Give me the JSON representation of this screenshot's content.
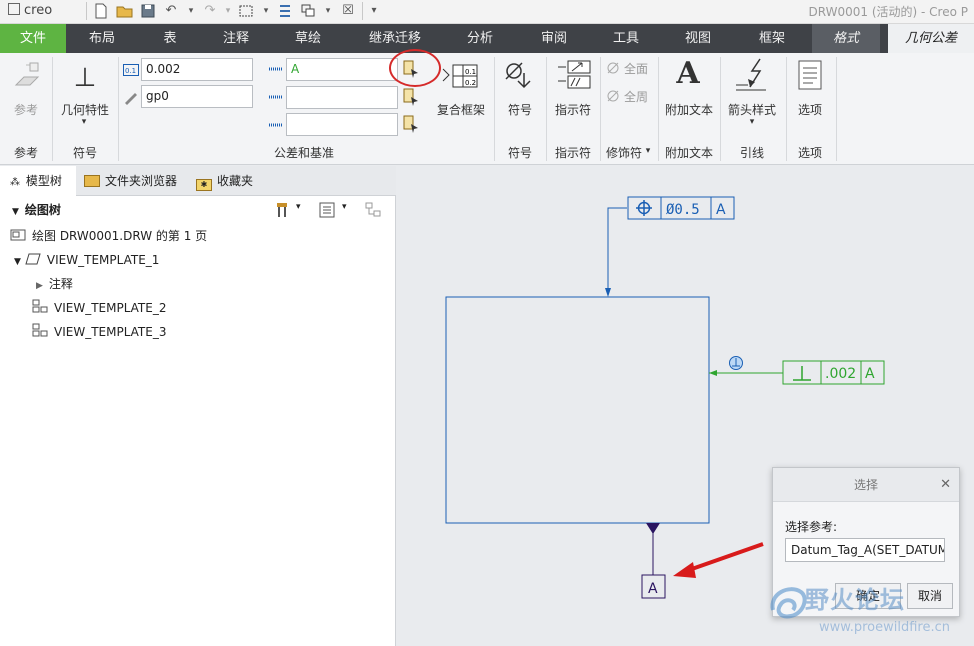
{
  "app": {
    "logo": "creo",
    "window_title": "DRW0001 (活动的) - Creo P"
  },
  "menu_tabs": {
    "file": "文件",
    "layout": "布局",
    "table": "表",
    "annotate": "注释",
    "sketch": "草绘",
    "legacy_migration": "继承迁移",
    "analysis": "分析",
    "review": "审阅",
    "tools": "工具",
    "view": "视图",
    "frame": "框架",
    "format": "格式",
    "gtol": "几何公差"
  },
  "ribbon": {
    "reference": {
      "button": "参考",
      "group": "参考"
    },
    "symbol_group": {
      "button": "几何特性",
      "group": "符号"
    },
    "tolerance": {
      "value": "0.002",
      "name": "gp0",
      "datum1": "A",
      "datum2": "",
      "datum3": "",
      "composite_frame": "复合框架",
      "group": "公差和基准"
    },
    "symbol2": {
      "button": "符号",
      "group": "符号"
    },
    "indicator": {
      "button": "指示符",
      "group": "指示符"
    },
    "modifier": {
      "all_around_1": "全面",
      "all_around_2": "全周",
      "group": "修饰符"
    },
    "additional_text": {
      "button": "附加文本",
      "group": "附加文本"
    },
    "leader": {
      "button": "箭头样式",
      "group": "引线"
    },
    "options": {
      "button": "选项",
      "group": "选项"
    }
  },
  "sidebar": {
    "tabs": [
      "模型树",
      "文件夹浏览器",
      "收藏夹"
    ],
    "tree_header": "绘图树",
    "items": [
      "绘图 DRW0001.DRW 的第 1 页",
      "VIEW_TEMPLATE_1",
      "注释",
      "VIEW_TEMPLATE_2",
      "VIEW_TEMPLATE_3"
    ]
  },
  "drawing": {
    "gtol_top": {
      "value": "Ø0.5",
      "datum": "A"
    },
    "gtol_right": {
      "value": ".002",
      "datum": "A"
    },
    "datum_tag": "A",
    "colors": {
      "blue": "#1a5fb4",
      "green": "#2fa52f",
      "purple": "#2a1460",
      "red_arrow": "#d81b1b"
    }
  },
  "dialog": {
    "title": "选择",
    "label": "选择参考:",
    "value": "Datum_Tag_A(SET_DATUM",
    "ok": "确定",
    "cancel": "取消"
  },
  "watermark": {
    "name": "野火论坛",
    "url": "www.proewildfire.cn"
  }
}
